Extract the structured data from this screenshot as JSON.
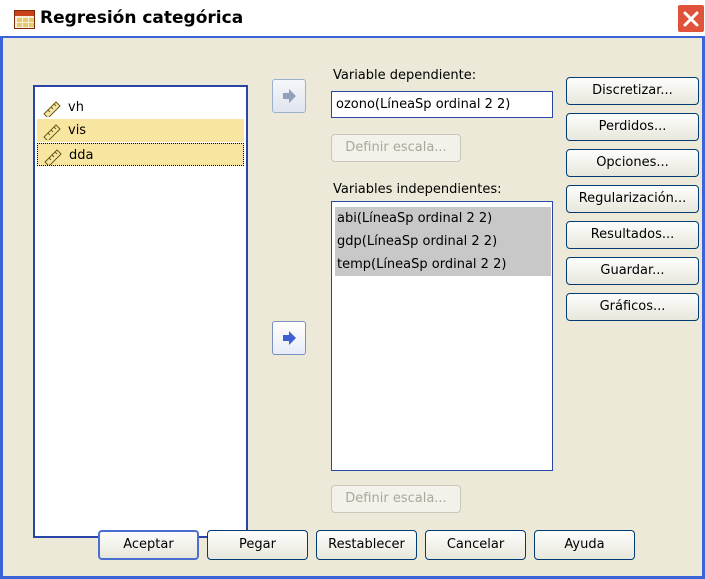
{
  "window": {
    "title": "Regresión categórica"
  },
  "source_variables": [
    {
      "label": "vh"
    },
    {
      "label": "vis"
    },
    {
      "label": "dda"
    }
  ],
  "dependent": {
    "label": "Variable dependiente:",
    "value": "ozono(LíneaSp ordinal 2 2)",
    "define_scale": "Definir escala..."
  },
  "independent": {
    "label": "Variables independientes:",
    "items": [
      {
        "label": "abi(LíneaSp ordinal 2 2)"
      },
      {
        "label": "gdp(LíneaSp ordinal 2 2)"
      },
      {
        "label": "temp(LíneaSp ordinal 2 2)"
      }
    ],
    "define_scale": "Definir escala..."
  },
  "side_buttons": {
    "discretize": "Discretizar...",
    "missing": "Perdidos...",
    "options": "Opciones...",
    "regularization": "Regularización...",
    "results": "Resultados...",
    "save": "Guardar...",
    "plots": "Gráficos..."
  },
  "bottom_buttons": {
    "ok": "Aceptar",
    "paste": "Pegar",
    "reset": "Restablecer",
    "cancel": "Cancelar",
    "help": "Ayuda"
  }
}
